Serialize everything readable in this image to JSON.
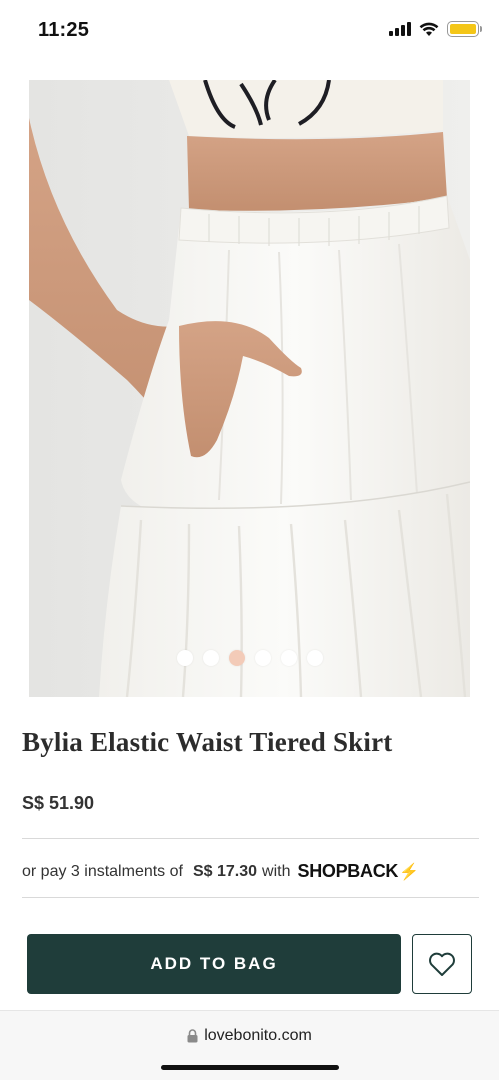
{
  "status_bar": {
    "time": "11:25",
    "icons": [
      "cellular-signal-icon",
      "wifi-icon",
      "battery-icon"
    ],
    "battery_color": "#f4c617"
  },
  "product": {
    "gallery": {
      "image": "model-wearing-white-tiered-skirt",
      "dot_count": 6,
      "active_index": 2,
      "active_color": "#f3cbb8"
    },
    "title": "Bylia Elastic Waist Tiered Skirt",
    "price": "S$ 51.90"
  },
  "installment": {
    "prefix": "or pay 3 instalments of",
    "amount": "S$ 17.30",
    "middle": "with",
    "brand": "SHOPBACK",
    "brand_icon": "lightning-bolt-icon"
  },
  "actions": {
    "add_to_bag": "ADD TO BAG",
    "wishlist_icon": "heart-icon",
    "button_color": "#1f3d3a"
  },
  "browser": {
    "url": "lovebonito.com",
    "lock_icon": "lock-icon"
  }
}
